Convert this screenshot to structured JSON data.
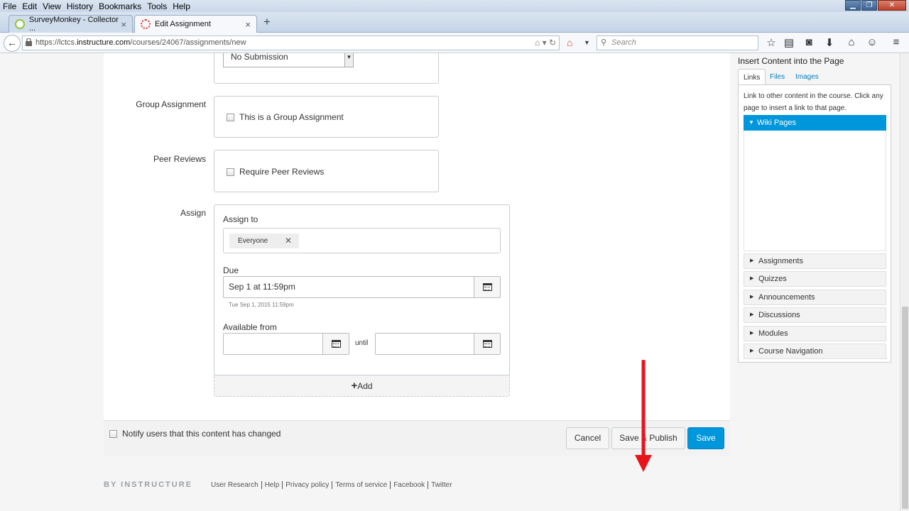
{
  "menu": [
    "File",
    "Edit",
    "View",
    "History",
    "Bookmarks",
    "Tools",
    "Help"
  ],
  "tabs": [
    {
      "label": "SurveyMonkey - Collector ...",
      "close": "×"
    },
    {
      "label": "Edit Assignment",
      "close": "×"
    }
  ],
  "new_tab": "+",
  "url": {
    "prefix": "https://lctcs.",
    "domain": "instructure.com",
    "path": "/courses/24067/assignments/new"
  },
  "search_placeholder": "Search",
  "form": {
    "submission_type_value": "No Submission",
    "group_label": "Group Assignment",
    "group_checkbox": "This is a Group Assignment",
    "peer_label": "Peer Reviews",
    "peer_checkbox": "Require Peer Reviews",
    "assign_label": "Assign",
    "assign_to_label": "Assign to",
    "assignee_token": "Everyone",
    "token_remove": "✕",
    "due_label": "Due",
    "due_value": "Sep 1 at 11:59pm",
    "due_hint": "Tue Sep 1, 2015 11:59pm",
    "available_label": "Available from",
    "until_label": "until",
    "add_plus": "+",
    "add_label": "Add"
  },
  "footer": {
    "notify_label": "Notify users that this content has changed",
    "cancel": "Cancel",
    "save_publish": "Save & Publish",
    "save": "Save"
  },
  "site_footer": {
    "brand": "BY INSTRUCTURE",
    "links": [
      "User Research",
      "Help",
      "Privacy policy",
      "Terms of service",
      "Facebook",
      "Twitter"
    ]
  },
  "sidebar": {
    "title": "Insert Content into the Page",
    "tabs": [
      "Links",
      "Files",
      "Images"
    ],
    "description": "Link to other content in the course. Click any page to insert a link to that page.",
    "wiki_pages": "Wiki Pages",
    "sections": [
      "Assignments",
      "Quizzes",
      "Announcements",
      "Discussions",
      "Modules",
      "Course Navigation"
    ]
  },
  "colors": {
    "primary": "#0096db",
    "annotation_arrow": "#e8141b"
  }
}
